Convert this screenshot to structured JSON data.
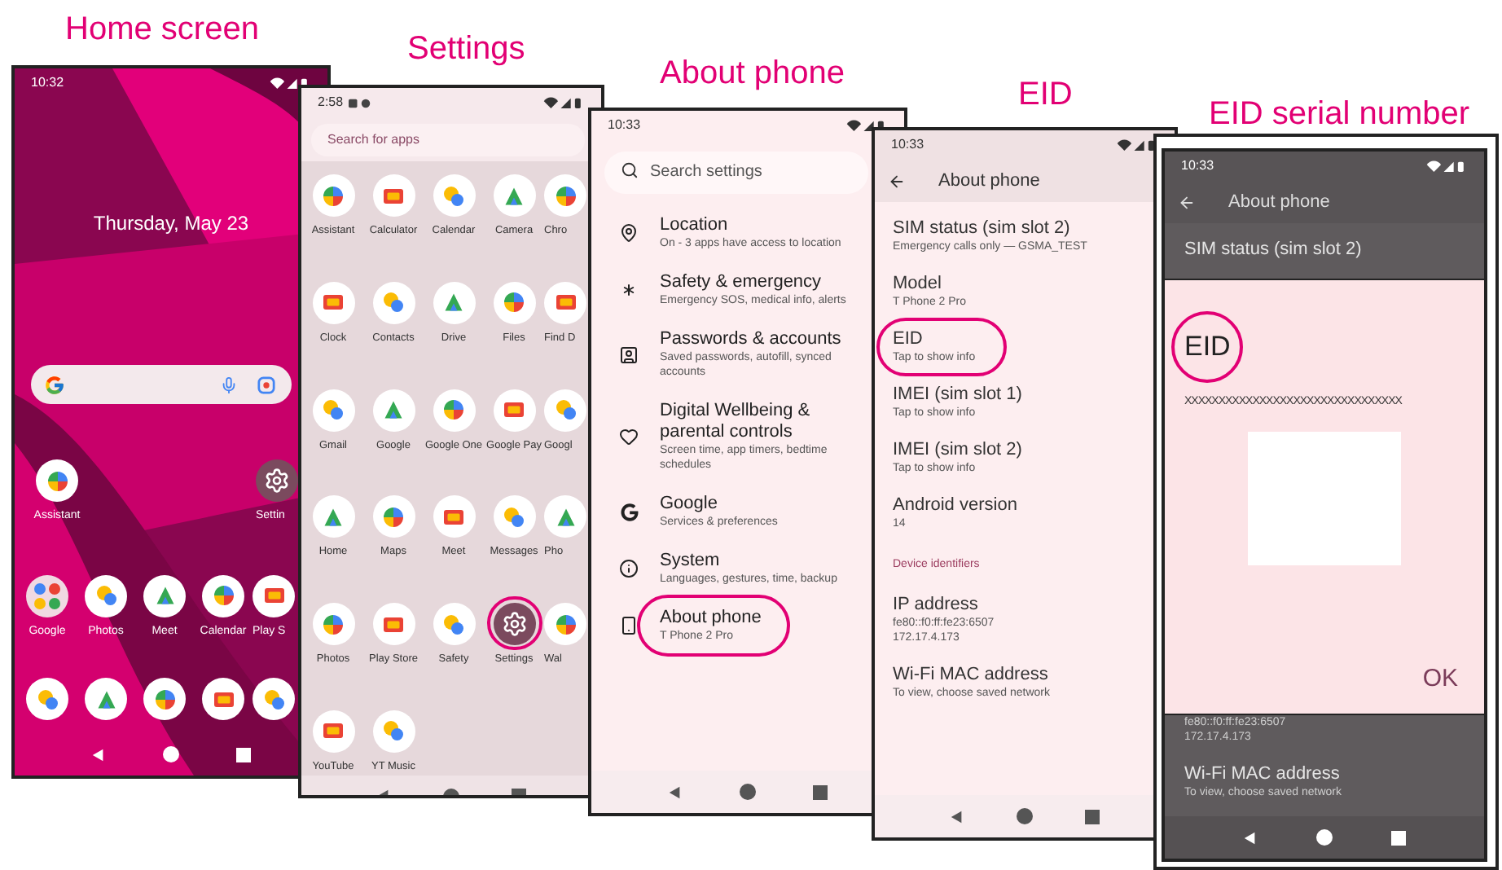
{
  "home_screen": {
    "caption": "Home screen",
    "time": "10:32",
    "date": "Thursday, May 23",
    "apps": [
      {
        "label": "Assistant",
        "kind": "app"
      },
      {
        "label": "Settin",
        "kind": "gear"
      }
    ],
    "row": [
      {
        "label": "Google",
        "kind": "folder"
      },
      {
        "label": "Photos",
        "kind": "app"
      },
      {
        "label": "Meet",
        "kind": "app"
      },
      {
        "label": "Calendar",
        "kind": "app"
      },
      {
        "label": "Play S",
        "kind": "app"
      }
    ]
  },
  "app_drawer": {
    "caption": "Settings",
    "time": "2:58",
    "search": {
      "placeholder": "Search for apps"
    },
    "apps": [
      {
        "label": "Assistant",
        "kind": "app",
        "highlighted": false
      },
      {
        "label": "Calculator",
        "kind": "app",
        "highlighted": false
      },
      {
        "label": "Calendar",
        "kind": "app",
        "highlighted": false
      },
      {
        "label": "Camera",
        "kind": "app",
        "highlighted": false
      },
      {
        "label": "Chro",
        "kind": "app",
        "highlighted": false
      },
      {
        "label": "Clock",
        "kind": "app",
        "highlighted": false
      },
      {
        "label": "Contacts",
        "kind": "app",
        "highlighted": false
      },
      {
        "label": "Drive",
        "kind": "app",
        "highlighted": false
      },
      {
        "label": "Files",
        "kind": "app",
        "highlighted": false
      },
      {
        "label": "Find D",
        "kind": "app",
        "highlighted": false
      },
      {
        "label": "Gmail",
        "kind": "app",
        "highlighted": false
      },
      {
        "label": "Google",
        "kind": "app",
        "highlighted": false
      },
      {
        "label": "Google One",
        "kind": "app",
        "highlighted": false
      },
      {
        "label": "Google Pay",
        "kind": "app",
        "highlighted": false
      },
      {
        "label": "Googl",
        "kind": "app",
        "highlighted": false
      },
      {
        "label": "Home",
        "kind": "app",
        "highlighted": false
      },
      {
        "label": "Maps",
        "kind": "app",
        "highlighted": false
      },
      {
        "label": "Meet",
        "kind": "app",
        "highlighted": false
      },
      {
        "label": "Messages",
        "kind": "app",
        "highlighted": false
      },
      {
        "label": "Pho",
        "kind": "app",
        "highlighted": false
      },
      {
        "label": "Photos",
        "kind": "app",
        "highlighted": false
      },
      {
        "label": "Play Store",
        "kind": "app",
        "highlighted": false
      },
      {
        "label": "Safety",
        "kind": "app",
        "highlighted": false
      },
      {
        "label": "Settings",
        "kind": "gear",
        "highlighted": true
      },
      {
        "label": "Wal",
        "kind": "app",
        "highlighted": false
      },
      {
        "label": "YouTube",
        "kind": "app",
        "highlighted": false
      },
      {
        "label": "YT Music",
        "kind": "app",
        "highlighted": false
      }
    ]
  },
  "settings": {
    "caption": "About phone",
    "time": "10:33",
    "search": {
      "placeholder": "Search settings"
    },
    "items": [
      {
        "kind": "location",
        "title": "Location",
        "subtitle": "On - 3 apps have access to location",
        "highlighted": false
      },
      {
        "kind": "safety",
        "title": "Safety & emergency",
        "subtitle": "Emergency SOS, medical info, alerts",
        "highlighted": false
      },
      {
        "kind": "passwords",
        "title": "Passwords & accounts",
        "subtitle": "Saved passwords, autofill, synced accounts",
        "highlighted": false
      },
      {
        "kind": "wellbeing",
        "title": "Digital Wellbeing & parental controls",
        "subtitle": "Screen time, app timers, bedtime schedules",
        "highlighted": false
      },
      {
        "kind": "google",
        "title": "Google",
        "subtitle": "Services & preferences",
        "highlighted": false
      },
      {
        "kind": "system",
        "title": "System",
        "subtitle": "Languages, gestures, time, backup",
        "highlighted": false
      },
      {
        "kind": "about",
        "title": "About phone",
        "subtitle": "T Phone 2 Pro",
        "highlighted": true
      }
    ]
  },
  "about_phone": {
    "caption": "EID",
    "time": "10:33",
    "title": "About phone",
    "items": [
      {
        "kind": "item",
        "title": "SIM status (sim slot 2)",
        "subtitle": "Emergency calls only — GSMA_TEST",
        "highlighted": false
      },
      {
        "kind": "item",
        "title": "Model",
        "subtitle": "T Phone 2 Pro",
        "highlighted": false
      },
      {
        "kind": "item",
        "title": "EID",
        "subtitle": "Tap to show info",
        "highlighted": true
      },
      {
        "kind": "item",
        "title": "IMEI (sim slot 1)",
        "subtitle": "Tap to show info",
        "highlighted": false
      },
      {
        "kind": "item",
        "title": "IMEI (sim slot 2)",
        "subtitle": "Tap to show info",
        "highlighted": false
      },
      {
        "kind": "item",
        "title": "Android version",
        "subtitle": "14",
        "highlighted": false
      },
      {
        "kind": "section",
        "title": "Device identifiers"
      },
      {
        "kind": "item",
        "title": "IP address",
        "subtitle": "fe80::f0:ff:fe23:6507\n172.17.4.173",
        "highlighted": false
      },
      {
        "kind": "item",
        "title": "Wi-Fi MAC address",
        "subtitle": "To view, choose saved network",
        "highlighted": false
      }
    ]
  },
  "eid_screen": {
    "caption": "EID serial number",
    "time": "10:33",
    "title": "About phone",
    "top_items": [
      {
        "title": "SIM status (sim slot 2)"
      }
    ],
    "bottom_items": [
      {
        "subtitle": "fe80::f0:ff:fe23:6507\n172.17.4.173"
      },
      {
        "title": "Wi-Fi MAC address",
        "subtitle": "To view, choose saved network"
      }
    ],
    "dialog": {
      "title": "EID",
      "highlighted": true,
      "value": "XXXXXXXXXXXXXXXXXXXXXXXXXXXXXXXX",
      "button": "OK"
    }
  }
}
